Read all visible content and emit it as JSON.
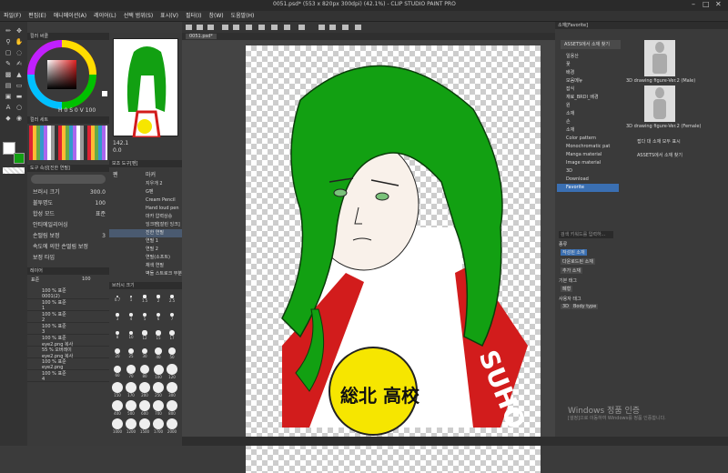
{
  "window": {
    "title": "0051.psd* (553 x 820px 300dpi) (42.1%)  - CLIP STUDIO PAINT PRO"
  },
  "menu": [
    "파일(F)",
    "편집(E)",
    "애니메이션(A)",
    "레이어(L)",
    "선택 범위(S)",
    "표시(V)",
    "필터(I)",
    "창(W)",
    "도움말(H)"
  ],
  "canvas_tab": "0051.psd*",
  "color_panel": {
    "title": "컬러 써클",
    "h_label": "H",
    "h_value": "0",
    "s_label": "S",
    "s_value": "0",
    "v_label": "V",
    "v_value": "100"
  },
  "color_set_title": "컬러 세트",
  "tool_property": {
    "title": "도구 속성[진한 연필]",
    "rows": [
      {
        "label": "브러시 크기",
        "value": "300.0"
      },
      {
        "label": "불투명도",
        "value": "100"
      },
      {
        "label": "합성 모드",
        "value": "표준"
      },
      {
        "label": "안티에일리어싱",
        "value": ""
      },
      {
        "label": "손떨림 보정",
        "value": "3"
      },
      {
        "label": "속도에 의한 손떨림 보정",
        "value": ""
      },
      {
        "label": "보정 타입",
        "value": ""
      }
    ]
  },
  "sub_tool": {
    "title": "보조 도구[펜]",
    "tabs": [
      "펜",
      "마커"
    ],
    "items": [
      "지우개 2",
      "G펜",
      "Cream Pencil",
      "Hand loud pen",
      "마카 압력상승",
      "잉크펜[잘린 잉크]",
      "진한 연필",
      "연필 1",
      "연필 2",
      "연필(소프트)",
      "채색 연필",
      "벽돌 스트로크 부분"
    ]
  },
  "brush_size": {
    "title": "브러시 크기",
    "sizes": [
      "0.7",
      "1",
      "1.5",
      "2",
      "2.5",
      "3",
      "4",
      "5",
      "6",
      "7",
      "8",
      "10",
      "12",
      "15",
      "17",
      "20",
      "25",
      "30",
      "40",
      "50",
      "60",
      "70",
      "80",
      "100",
      "120",
      "150",
      "170",
      "200",
      "250",
      "300",
      "400",
      "500",
      "600",
      "700",
      "800",
      "1000",
      "1200",
      "1500",
      "1700",
      "2000"
    ]
  },
  "layers": {
    "title": "레이어",
    "blend": "표준",
    "opacity": "100",
    "items": [
      {
        "name": "100 % 표준",
        "sub": "0001(2)"
      },
      {
        "name": "100 % 표준",
        "sub": "1"
      },
      {
        "name": "100 % 표준",
        "sub": "2"
      },
      {
        "name": "100 % 표준",
        "sub": "3"
      },
      {
        "name": "100 % 표준",
        "sub": "eye2.png 복사"
      },
      {
        "name": "55 % 오버레이",
        "sub": "eye2.png 복사"
      },
      {
        "name": "100 % 표준",
        "sub": "eye2.png"
      },
      {
        "name": "100 % 표준",
        "sub": "4"
      }
    ]
  },
  "canvas": {
    "zoom_label": "142.1",
    "rotate_label": "0.0",
    "jersey_text": "SUHO",
    "badge_text": "総北 高校"
  },
  "material": {
    "title": "소재[Favorite]",
    "header_button": "ASSETS에서 소재 찾기",
    "tree": [
      "일용산",
      "꽃",
      "배경",
      "모음메뉴",
      "잡식",
      "재료_BRDI_배경",
      "원",
      "소재",
      "손",
      "소재",
      "Color pattern",
      "Monochromatic pat",
      "Manga material",
      "Image material",
      "3D",
      "Download",
      "Favorite"
    ],
    "items": [
      {
        "label": "3D drawing figure-Ver.2 (Male)"
      },
      {
        "label": "3D drawing figure-Ver.2 (Female)"
      }
    ],
    "show_all": "접다 대 소재 모두 표시",
    "assets_link": "ASSETS에서 소재 찾기",
    "search_placeholder": "검색 키워드를 입력하...",
    "tag_heading": "종류",
    "tags": [
      "작성된 소재",
      "다운로드된 소재",
      "추가 소재"
    ],
    "default_tag_heading": "기본 태그",
    "default_tags": [
      "폐형"
    ],
    "user_tag_heading": "사용자 태그",
    "user_tags": [
      "3D",
      "Body type"
    ]
  },
  "watermark": {
    "line1": "Windows 정품 인증",
    "line2": "[설정]으로 이동하여 Windows를 정품 인증합니다."
  },
  "colors": {
    "accent_blue": "#3a6fb2",
    "hair_green": "#12a012",
    "jersey_red": "#d21c1c",
    "badge_yellow": "#f6e600"
  }
}
